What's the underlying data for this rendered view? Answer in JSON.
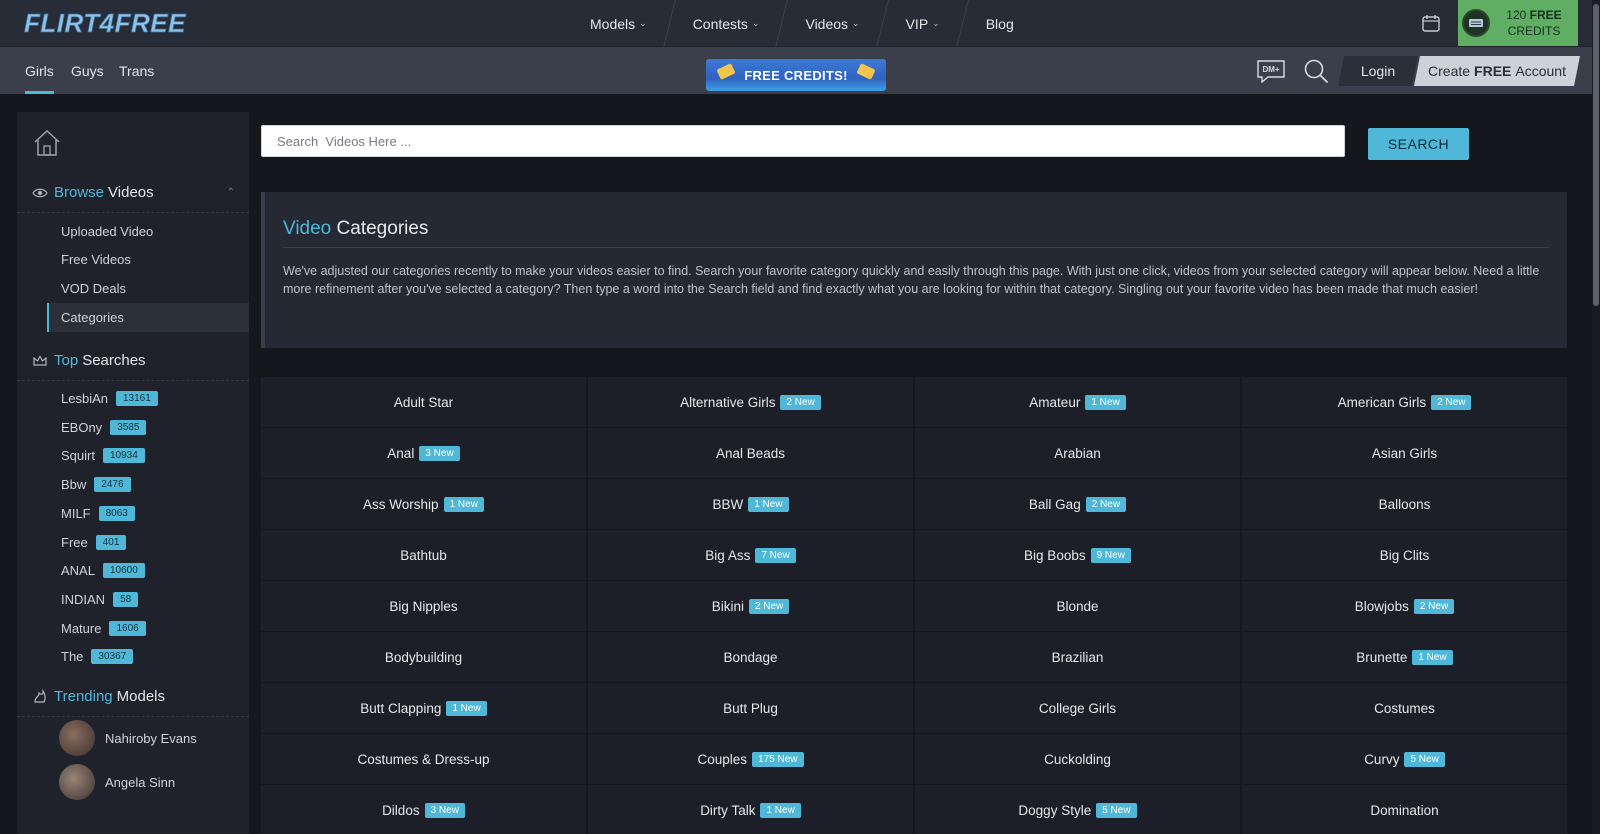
{
  "brand": {
    "logo_text": "FLIRT4FREE"
  },
  "main_nav": [
    {
      "label": "Models",
      "dropdown": true
    },
    {
      "label": "Contests",
      "dropdown": true
    },
    {
      "label": "Videos",
      "dropdown": true
    },
    {
      "label": "VIP",
      "dropdown": true
    },
    {
      "label": "Blog",
      "dropdown": false
    }
  ],
  "credits": {
    "amount": "120",
    "free": "FREE",
    "label": "CREDITS"
  },
  "gender_tabs": [
    {
      "label": "Girls",
      "active": true
    },
    {
      "label": "Guys",
      "active": false
    },
    {
      "label": "Trans",
      "active": false
    }
  ],
  "banner": {
    "label": "FREE CREDITS!"
  },
  "header_actions": {
    "dm_label": "DM+",
    "login": "Login",
    "create_pre": "Create",
    "create_bold": "FREE",
    "create_post": "Account"
  },
  "sidebar": {
    "browse": {
      "accent": "Browse",
      "rest": "Videos"
    },
    "links": [
      {
        "label": "Uploaded Video",
        "active": false
      },
      {
        "label": "Free Videos",
        "active": false
      },
      {
        "label": "VOD Deals",
        "active": false
      },
      {
        "label": "Categories",
        "active": true
      }
    ],
    "top_searches": {
      "accent": "Top",
      "rest": "Searches",
      "items": [
        {
          "label": "LesbiAn",
          "count": "13161"
        },
        {
          "label": "EBOny",
          "count": "3585"
        },
        {
          "label": "Squirt",
          "count": "10934"
        },
        {
          "label": "Bbw",
          "count": "2476"
        },
        {
          "label": "MILF",
          "count": "8063"
        },
        {
          "label": "Free",
          "count": "401"
        },
        {
          "label": "ANAL",
          "count": "10600"
        },
        {
          "label": "INDIAN",
          "count": "58"
        },
        {
          "label": "Mature",
          "count": "1606"
        },
        {
          "label": "The",
          "count": "30367"
        }
      ]
    },
    "trending": {
      "accent": "Trending",
      "rest": "Models",
      "models": [
        {
          "name": "Nahiroby Evans"
        },
        {
          "name": "Angela Sinn"
        }
      ]
    }
  },
  "search": {
    "placeholder": "Search  Videos Here ...",
    "button": "SEARCH"
  },
  "info": {
    "title_accent": "Video",
    "title_rest": "Categories",
    "text": "We've adjusted our categories recently to make your videos easier to find. Search your favorite category quickly and easily through this page. With just one click, videos from your selected category will appear below. Need a little more refinement after you've selected a category? Then type a word into the Search field and find exactly what you are looking for within that category. Singling out your favorite video has been made that much easier!"
  },
  "categories": [
    {
      "name": "Adult Star",
      "badge": ""
    },
    {
      "name": "Alternative Girls",
      "badge": "2 New"
    },
    {
      "name": "Amateur",
      "badge": "1 New"
    },
    {
      "name": "American Girls",
      "badge": "2 New"
    },
    {
      "name": "Anal",
      "badge": "3 New"
    },
    {
      "name": "Anal Beads",
      "badge": ""
    },
    {
      "name": "Arabian",
      "badge": ""
    },
    {
      "name": "Asian Girls",
      "badge": ""
    },
    {
      "name": "Ass Worship",
      "badge": "1 New"
    },
    {
      "name": "BBW",
      "badge": "1 New"
    },
    {
      "name": "Ball Gag",
      "badge": "2 New"
    },
    {
      "name": "Balloons",
      "badge": ""
    },
    {
      "name": "Bathtub",
      "badge": ""
    },
    {
      "name": "Big Ass",
      "badge": "7 New"
    },
    {
      "name": "Big Boobs",
      "badge": "9 New"
    },
    {
      "name": "Big Clits",
      "badge": ""
    },
    {
      "name": "Big Nipples",
      "badge": ""
    },
    {
      "name": "Bikini",
      "badge": "2 New"
    },
    {
      "name": "Blonde",
      "badge": ""
    },
    {
      "name": "Blowjobs",
      "badge": "2 New"
    },
    {
      "name": "Bodybuilding",
      "badge": ""
    },
    {
      "name": "Bondage",
      "badge": ""
    },
    {
      "name": "Brazilian",
      "badge": ""
    },
    {
      "name": "Brunette",
      "badge": "1 New"
    },
    {
      "name": "Butt Clapping",
      "badge": "1 New"
    },
    {
      "name": "Butt Plug",
      "badge": ""
    },
    {
      "name": "College Girls",
      "badge": ""
    },
    {
      "name": "Costumes",
      "badge": ""
    },
    {
      "name": "Costumes & Dress-up",
      "badge": ""
    },
    {
      "name": "Couples",
      "badge": "175 New"
    },
    {
      "name": "Cuckolding",
      "badge": ""
    },
    {
      "name": "Curvy",
      "badge": "5 New"
    },
    {
      "name": "Dildos",
      "badge": "3 New"
    },
    {
      "name": "Dirty Talk",
      "badge": "1 New"
    },
    {
      "name": "Doggy Style",
      "badge": "5 New"
    },
    {
      "name": "Domination",
      "badge": ""
    }
  ],
  "icons": {
    "logo": "flirt4free-logo",
    "calendar": "calendar-icon",
    "credits": "credits-coin-icon",
    "dm": "dm-chat-icon",
    "search": "search-icon",
    "home": "home-icon",
    "eye": "eye-icon",
    "crown": "crown-icon",
    "trending": "trending-icon"
  },
  "colors": {
    "accent": "#4fb8d8",
    "credits_green": "#5fae63",
    "topbar": "#282c37",
    "subbar": "#3b3f4b",
    "page_bg": "#15171d"
  }
}
